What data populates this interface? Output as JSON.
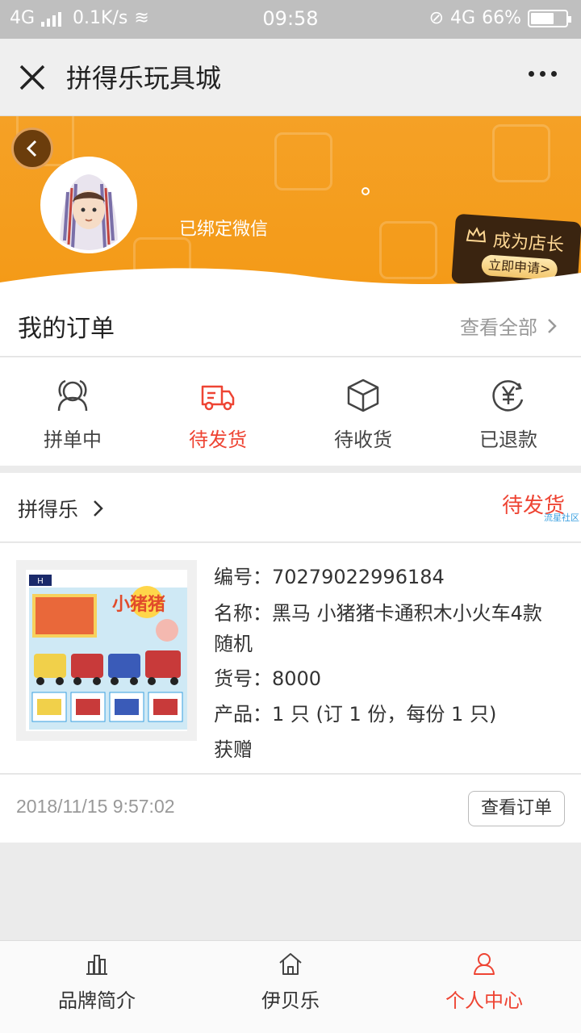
{
  "statusbar": {
    "network_left": "4G",
    "speed": "0.1K/s",
    "time": "09:58",
    "network_right": "4G",
    "battery": "66%",
    "battery_level": 0.66
  },
  "titlebar": {
    "title": "拼得乐玩具城",
    "close_icon": "close-icon",
    "more_icon": "more-dots-icon"
  },
  "profile": {
    "wechat_status": "已绑定微信",
    "shop_badge_title": "成为店长",
    "shop_badge_button": "立即申请>"
  },
  "orders": {
    "title": "我的订单",
    "view_all": "查看全部",
    "statuses": [
      {
        "label": "拼单中",
        "icon": "group-icon",
        "active": false
      },
      {
        "label": "待发货",
        "icon": "truck-icon",
        "active": true
      },
      {
        "label": "待收货",
        "icon": "box-icon",
        "active": false
      },
      {
        "label": "已退款",
        "icon": "yuan-icon",
        "active": false
      }
    ]
  },
  "order": {
    "seller": "拼得乐",
    "status": "待发货",
    "watermark": "流星社区",
    "product_name_art": "小猪猪",
    "lines": {
      "number": "编号：70279022996184",
      "name": "名称：黑马 小猪猪卡通积木小火车4款随机",
      "sku": "货号：8000",
      "product": "产品：1 只 (订 1 份，每份 1 只)",
      "gift": "获赠"
    },
    "date": "2018/11/15 9:57:02",
    "view_button": "查看订单"
  },
  "bottom_nav": [
    {
      "label": "品牌简介",
      "icon": "brand-icon",
      "active": false
    },
    {
      "label": "伊贝乐",
      "icon": "home-icon",
      "active": false
    },
    {
      "label": "个人中心",
      "icon": "user-icon",
      "active": true
    }
  ],
  "colors": {
    "accent": "#ee4433",
    "header_orange": "#f49a17",
    "badge_dark": "#3a2410"
  }
}
